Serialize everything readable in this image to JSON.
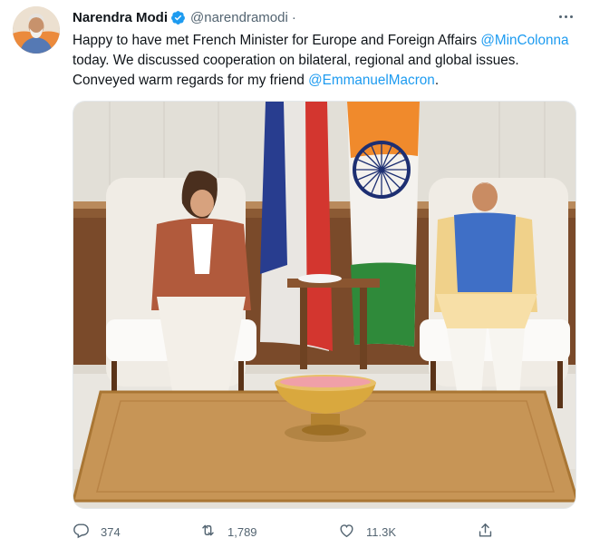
{
  "tweet": {
    "author_name": "Narendra Modi",
    "author_handle": "@narendramodi",
    "separator": "·",
    "verified_icon": "verified-badge-icon",
    "text_parts": [
      {
        "type": "text",
        "value": "Happy to have met French Minister for Europe and Foreign Affairs "
      },
      {
        "type": "mention",
        "value": "@MinColonna"
      },
      {
        "type": "text",
        "value": " today. We discussed cooperation on bilateral, regional and global issues. Conveyed warm regards for my friend "
      },
      {
        "type": "mention",
        "value": "@EmmanuelMacron"
      },
      {
        "type": "text",
        "value": "."
      }
    ],
    "text_0": "Happy to have met French Minister for Europe and Foreign Affairs ",
    "mention_1": "@MinColonna",
    "text_1": " today. We discussed cooperation on bilateral, regional and global issues. Conveyed warm regards for my friend ",
    "mention_2": "@EmmanuelMacron",
    "text_2": "."
  },
  "metrics": {
    "replies": "374",
    "retweets": "1,789",
    "likes": "11.3K"
  },
  "colors": {
    "link": "#1d9bf0",
    "secondary_text": "#536471",
    "verified": "#1d9bf0"
  },
  "icons": {
    "more": "more-icon",
    "reply": "reply-icon",
    "retweet": "retweet-icon",
    "like": "heart-icon",
    "share": "share-icon"
  }
}
